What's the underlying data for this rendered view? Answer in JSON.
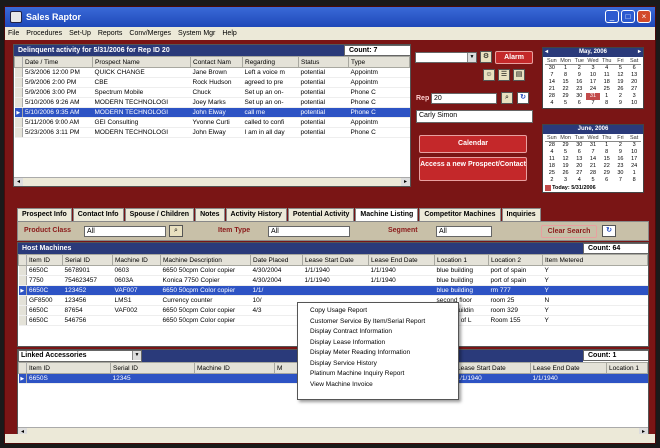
{
  "window": {
    "title": "Sales Raptor"
  },
  "menu": [
    "File",
    "Procedures",
    "Set-Up",
    "Reports",
    "Conv/Merges",
    "System Mgr",
    "Help"
  ],
  "delinquent": {
    "title": "Delinquent activity for 5/31/2006 for Rep ID 20",
    "count_label": "Count: 7",
    "columns": [
      "Date / Time",
      "Prospect Name",
      "Contact Nam",
      "Regarding",
      "Status",
      "Type"
    ],
    "rows": [
      [
        "5/3/2006 12:00 PM",
        "QUICK CHANGE",
        "Jane Brown",
        "Left a voice m",
        "potential",
        "Appointm"
      ],
      [
        "5/9/2006 2:00 PM",
        "CBE",
        "Rock Hudson",
        "agreed to pre",
        "potential",
        "Appointm"
      ],
      [
        "5/9/2006 3:00 PM",
        "Spectrum Mobile",
        "Chuck",
        "Set up an on-",
        "potential",
        "Phone C"
      ],
      [
        "5/10/2006 9:26 AM",
        "MODERN TECHNOLOGI",
        "Joey Marks",
        "Set up an on-",
        "potential",
        "Phone C"
      ],
      [
        "5/10/2006 9:35 AM",
        "MODERN TECHNOLOGI",
        "John Elway",
        "call me",
        "potential",
        "Phone C"
      ],
      [
        "5/11/2006 9:00 AM",
        "GEI Consulting",
        "Yvonne Curti",
        "called to confi",
        "potential",
        "Appointm"
      ],
      [
        "5/23/2006 3:11 PM",
        "MODERN TECHNOLOGI",
        "John Elway",
        "I am in all day",
        "potential",
        "Phone C"
      ]
    ],
    "selected_row": 4
  },
  "controls": {
    "alarm_label": "Alarm",
    "rep_label": "Rep",
    "rep_value": "20",
    "rep_name": "Carly Simon",
    "calendar_label": "Calendar",
    "new_prospect_label": "Access a new Prospect/Contact"
  },
  "calendar": {
    "may": {
      "title": "May, 2006",
      "day_names": [
        "Sun",
        "Mon",
        "Tue",
        "Wed",
        "Thu",
        "Fri",
        "Sat"
      ],
      "days": [
        "30",
        "1",
        "2",
        "3",
        "4",
        "5",
        "6",
        "7",
        "8",
        "9",
        "10",
        "11",
        "12",
        "13",
        "14",
        "15",
        "16",
        "17",
        "18",
        "19",
        "20",
        "21",
        "22",
        "23",
        "24",
        "25",
        "26",
        "27",
        "28",
        "29",
        "30",
        "31",
        "1",
        "2",
        "3",
        "4",
        "5",
        "6",
        "7",
        "8",
        "9",
        "10"
      ],
      "highlight": "31"
    },
    "june": {
      "title": "June, 2006",
      "day_names": [
        "Sun",
        "Mon",
        "Tue",
        "Wed",
        "Thu",
        "Fri",
        "Sat"
      ],
      "days": [
        "28",
        "29",
        "30",
        "31",
        "1",
        "2",
        "3",
        "4",
        "5",
        "6",
        "7",
        "8",
        "9",
        "10",
        "11",
        "12",
        "13",
        "14",
        "15",
        "16",
        "17",
        "18",
        "19",
        "20",
        "21",
        "22",
        "23",
        "24",
        "25",
        "26",
        "27",
        "28",
        "29",
        "30",
        "1",
        "2",
        "3",
        "4",
        "5",
        "6",
        "7",
        "8"
      ],
      "today_label": "Today: 5/31/2006"
    }
  },
  "tabs": [
    "Prospect Info",
    "Contact Info",
    "Spouse / Children",
    "Notes",
    "Activity History",
    "Potential Activity",
    "Machine Listing",
    "Competitor Machines",
    "Inquiries"
  ],
  "active_tab": "Machine Listing",
  "filters": {
    "product_class_label": "Product Class",
    "product_class_value": "All",
    "item_type_label": "Item Type",
    "item_type_value": "All",
    "segment_label": "Segment",
    "segment_value": "All",
    "clear_label": "Clear Search"
  },
  "host": {
    "title": "Host Machines",
    "count_label": "Count: 64",
    "columns": [
      "Item ID",
      "Serial ID",
      "Machine ID",
      "Machine Description",
      "Date Placed",
      "Lease Start Date",
      "Lease End Date",
      "Location 1",
      "Location 2",
      "Item Metered"
    ],
    "rows": [
      [
        "6650C",
        "5678901",
        "0603",
        "6650 50cpm Color copier",
        "4/30/2004",
        "1/1/1940",
        "1/1/1940",
        "blue building",
        "port of spain",
        "Y"
      ],
      [
        "7750",
        "754623457",
        "0603A",
        "Konica 7750 Copier",
        "4/30/2004",
        "1/1/1940",
        "1/1/1940",
        "blue building",
        "port of spain",
        "Y"
      ],
      [
        "6650C",
        "123452",
        "VAF007",
        "6650 50cpm Color copier",
        "1/1/",
        "",
        "",
        "blue building",
        "rm 777",
        "Y"
      ],
      [
        "GF8500",
        "123456",
        "LMS1",
        "Currency counter",
        "10/",
        "",
        "",
        "second floor",
        "room 25",
        "N"
      ],
      [
        "6650C",
        "87654",
        "VAF002",
        "6650 50cpm Color copier",
        "4/3",
        "",
        "",
        "green buildin",
        "room 329",
        "Y"
      ],
      [
        "6650C",
        "546756",
        "",
        "6650 50cpm Color copier",
        "",
        "",
        "",
        "Ministry of L",
        "Room 155",
        "Y"
      ]
    ],
    "selected_row": 2
  },
  "context_menu": [
    "Copy Usage Report",
    "Customer Service By Item/Serial Report",
    "Display Contract Information",
    "Display Lease Information",
    "Display Meter Reading Information",
    "Display Service History",
    "Platinum Machine Inquiry Report",
    "View Machine Invoice"
  ],
  "linked": {
    "title": "Linked Accessories",
    "count_label": "Count: 1",
    "columns": [
      "Item ID",
      "Serial ID",
      "Machine ID",
      "M",
      "Lease Start Date",
      "Lease End Date",
      "Location 1"
    ],
    "rows": [
      [
        "6650S",
        "12345",
        "",
        "",
        "1/1/1940",
        "1/1/1940",
        ""
      ]
    ]
  },
  "colors": {
    "background": "#7a1515",
    "header": "#2a3a7a",
    "selection": "#2d53c4",
    "button": "#c4282a"
  }
}
